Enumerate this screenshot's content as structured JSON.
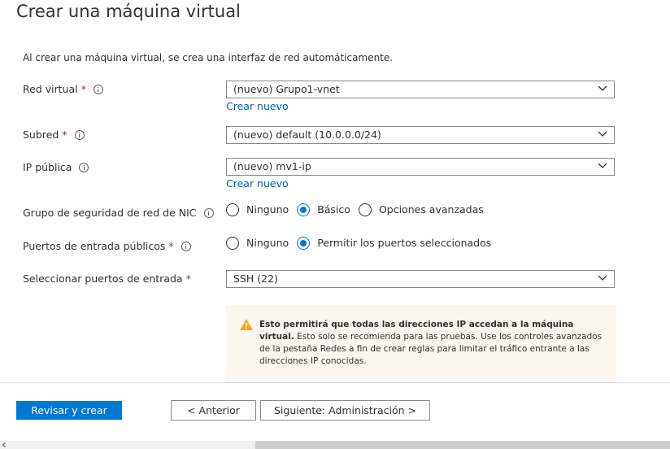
{
  "page": {
    "title": "Crear una máquina virtual",
    "intro": "Al crear una máquina virtual, se crea una interfaz de red automáticamente."
  },
  "fields": {
    "virtual_network": {
      "label": "Red virtual",
      "required": "*",
      "value": "(nuevo) Grupo1-vnet",
      "create_link": "Crear nuevo"
    },
    "subnet": {
      "label": "Subred",
      "required": "*",
      "value": "(nuevo) default (10.0.0.0/24)"
    },
    "public_ip": {
      "label": "IP pública",
      "value": "(nuevo) mv1-ip",
      "create_link": "Crear nuevo"
    },
    "nic_security_group": {
      "label": "Grupo de seguridad de red de NIC",
      "options": [
        "Ninguno",
        "Básico",
        "Opciones avanzadas"
      ],
      "selected": "Básico"
    },
    "public_inbound_ports": {
      "label": "Puertos de entrada públicos",
      "required": "*",
      "options": [
        "Ninguno",
        "Permitir los puertos seleccionados"
      ],
      "selected": "Permitir los puertos seleccionados"
    },
    "select_inbound_ports": {
      "label": "Seleccionar puertos de entrada",
      "required": "*",
      "value": "SSH (22)"
    }
  },
  "warning": {
    "bold": "Esto permitirá que todas las direcciones IP accedan a la máquina virtual.",
    "text": " Esto solo se recomienda para las pruebas.  Use los controles avanzados de la pestaña Redes a fin de crear reglas para limitar el tráfico entrante a las direcciones IP conocidas."
  },
  "footer": {
    "review_create": "Revisar y crear",
    "previous": "< Anterior",
    "next": "Siguiente: Administración >"
  },
  "colors": {
    "accent": "#0078d4",
    "link": "#0063b1",
    "required": "#a4262c",
    "warning_icon": "#f7a51c",
    "warning_bg": "#fdf6ee"
  },
  "icons": {
    "info": "info-icon",
    "chevron": "chevron-down-icon",
    "warning": "warning-icon"
  }
}
